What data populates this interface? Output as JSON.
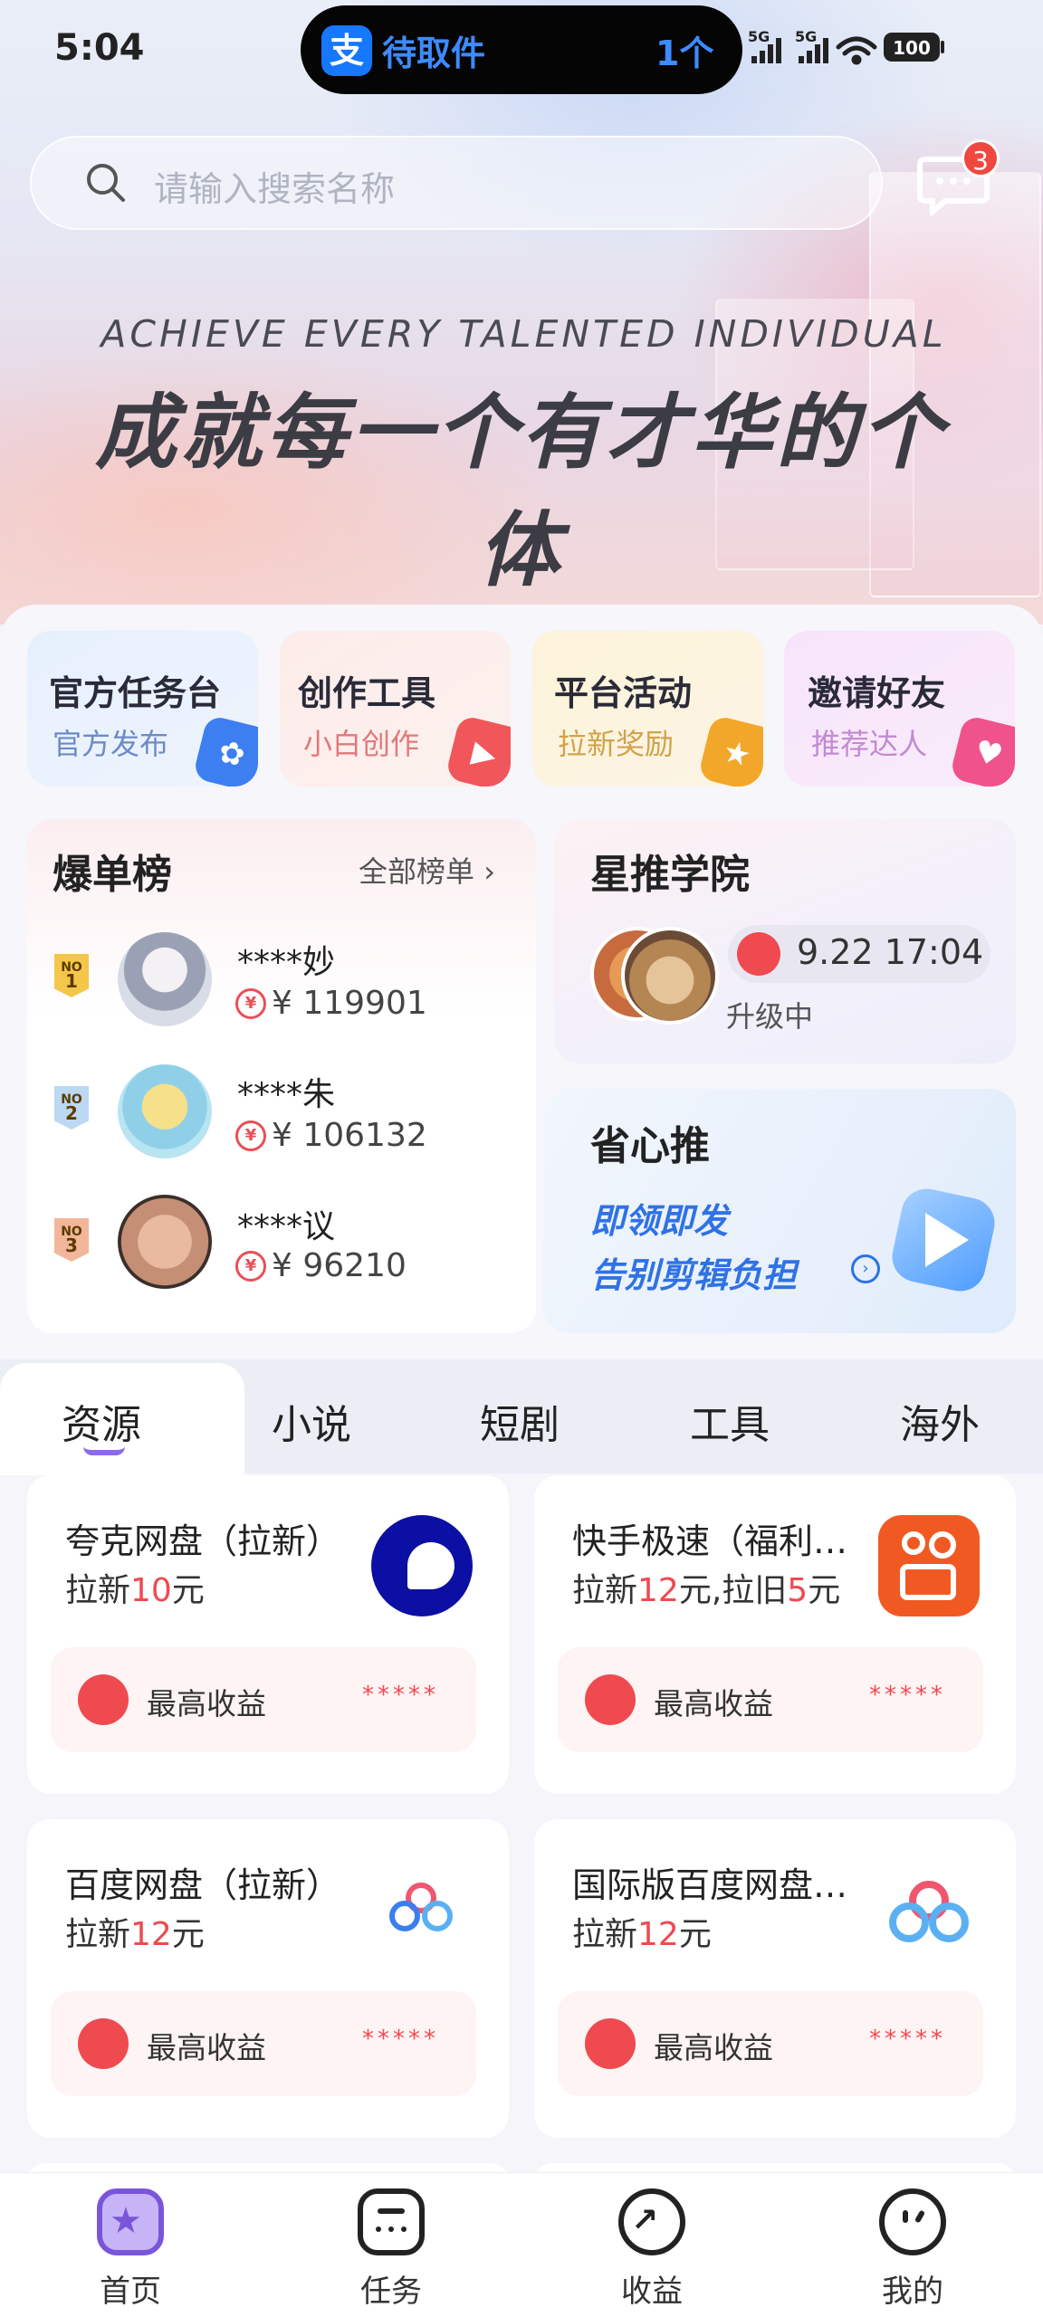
{
  "status_bar": {
    "time": "5:04",
    "signal1": "5G",
    "signal2": "5G",
    "battery": "100"
  },
  "island": {
    "app_icon": "支",
    "title": "待取件",
    "count": "1个"
  },
  "search": {
    "placeholder": "请输入搜索名称"
  },
  "messages": {
    "badge": "3"
  },
  "hero": {
    "en": "ACHIEVE EVERY TALENTED INDIVIDUAL",
    "cn": "成就每一个有才华的个体"
  },
  "quick_actions": [
    {
      "title": "官方任务台",
      "subtitle": "官方发布",
      "color": "#3d7ff0"
    },
    {
      "title": "创作工具",
      "subtitle": "小白创作",
      "color": "#f0565a"
    },
    {
      "title": "平台活动",
      "subtitle": "拉新奖励",
      "color": "#f3a72a"
    },
    {
      "title": "邀请好友",
      "subtitle": "推荐达人",
      "color": "#f0528c"
    }
  ],
  "leaderboard": {
    "title": "爆单榜",
    "all_label": "全部榜单",
    "entries": [
      {
        "rank": "1",
        "medal": "NO",
        "name": "****妙",
        "amount": "¥ 119901"
      },
      {
        "rank": "2",
        "medal": "NO",
        "name": "****朱",
        "amount": "¥ 106132"
      },
      {
        "rank": "3",
        "medal": "NO",
        "name": "****议",
        "amount": "¥ 96210"
      }
    ]
  },
  "academy": {
    "title": "星推学院",
    "live_time": "9.22 17:04",
    "status": "升级中"
  },
  "promo": {
    "title": "省心推",
    "line1": "即领即发",
    "line2": "告别剪辑负担"
  },
  "tabs": [
    "资源",
    "小说",
    "短剧",
    "工具",
    "海外"
  ],
  "resources": [
    {
      "title": "夸克网盘（拉新）",
      "sub_prefix": "拉新",
      "sub_hl1": "10",
      "sub_mid": "元",
      "sub_hl2": "",
      "sub_tail": "",
      "bar_label": "最高收益",
      "stars": "*****"
    },
    {
      "title": "快手极速（福利…",
      "sub_prefix": "拉新",
      "sub_hl1": "12",
      "sub_mid": "元,拉旧",
      "sub_hl2": "5",
      "sub_tail": "元",
      "bar_label": "最高收益",
      "stars": "*****"
    },
    {
      "title": "百度网盘（拉新）",
      "sub_prefix": "拉新",
      "sub_hl1": "12",
      "sub_mid": "元",
      "sub_hl2": "",
      "sub_tail": "",
      "bar_label": "最高收益",
      "stars": "*****"
    },
    {
      "title": "国际版百度网盘…",
      "sub_prefix": "拉新",
      "sub_hl1": "12",
      "sub_mid": "元",
      "sub_hl2": "",
      "sub_tail": "",
      "bar_label": "最高收益",
      "stars": "*****"
    }
  ],
  "nav": [
    "首页",
    "任务",
    "收益",
    "我的"
  ],
  "colors": {
    "accent_red": "#ee4a50",
    "accent_purple": "#8b6be8",
    "link_blue": "#2f72e6"
  }
}
